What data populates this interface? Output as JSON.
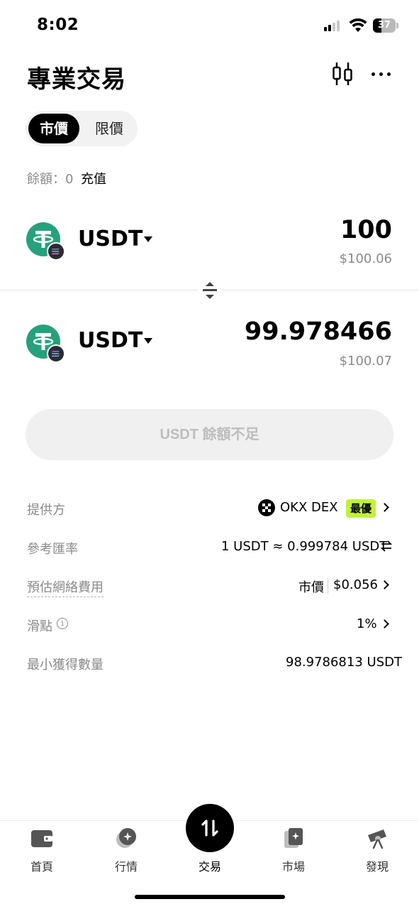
{
  "status_bar": {
    "time": "8:02",
    "battery": "37",
    "battery_level": 0.37
  },
  "header": {
    "title": "專業交易",
    "chart_icon": "candlestick-chart-icon",
    "more_icon": "more-dots-icon"
  },
  "tabs": [
    {
      "label": "市價",
      "active": true
    },
    {
      "label": "限價",
      "active": false
    }
  ],
  "balance": {
    "label": "餘額：0",
    "deposit_label": "充值"
  },
  "from_token": {
    "symbol": "USDT",
    "amount": "100",
    "usd_value": "$100.06",
    "icon": "usdt-icon",
    "chain_icon": "solana-icon"
  },
  "to_token": {
    "symbol": "USDT",
    "amount": "99.978466",
    "usd_value": "$100.07",
    "icon": "usdt-icon",
    "chain_icon": "solana-icon"
  },
  "main_button": {
    "label": "USDT 餘額不足"
  },
  "details": {
    "provider": {
      "label": "提供方",
      "value": "OKX DEX",
      "badge": "最優"
    },
    "rate": {
      "label": "參考匯率",
      "value": "1 USDT ≈ 0.999784 USDT"
    },
    "network_fee": {
      "label": "預估網絡費用",
      "mode": "市價",
      "value": "$0.056"
    },
    "slippage": {
      "label": "滑點",
      "value": "1%"
    },
    "min_received": {
      "label": "最小獲得數量",
      "value": "98.9786813 USDT"
    }
  },
  "tabbar": [
    {
      "label": "首頁",
      "icon": "wallet-icon"
    },
    {
      "label": "行情",
      "icon": "market-icon"
    },
    {
      "label": "交易",
      "icon": "swap-arrows-icon"
    },
    {
      "label": "市場",
      "icon": "nft-market-icon"
    },
    {
      "label": "發現",
      "icon": "telescope-icon"
    }
  ],
  "colors": {
    "accent": "#bff23a",
    "tether": "#26a17b",
    "muted": "#8a8a8a"
  }
}
